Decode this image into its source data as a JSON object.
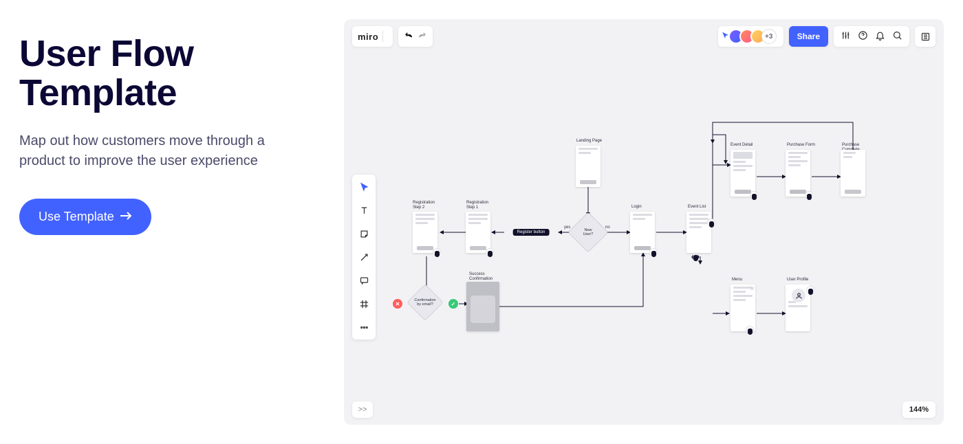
{
  "promo": {
    "title": "User Flow Template",
    "subtitle": "Map out how customers move through a product to improve the user experience",
    "cta": "Use Template"
  },
  "topbar": {
    "logo": "miro",
    "share": "Share",
    "avatar_extra": "+3"
  },
  "zoom": "144%",
  "collapse": ">>",
  "flow": {
    "nodes": {
      "reg2": "Registration\nStep 2",
      "reg1": "Registration\nStep 1",
      "landing": "Landing Page",
      "login": "Login",
      "eventlist": "Event List",
      "eventdetail": "Event Detail",
      "purchaseform": "Purchase Form",
      "purchasecomplete": "Purchase\nComplete",
      "successconf": "Success\nConfirmation",
      "menu": "Menu",
      "userprofile": "User Profile"
    },
    "diamonds": {
      "newuser": "New\nUser?",
      "confemail": "Confirmation\nby email?"
    },
    "wire_label": "Register button",
    "yes": "yes",
    "no": "no"
  }
}
